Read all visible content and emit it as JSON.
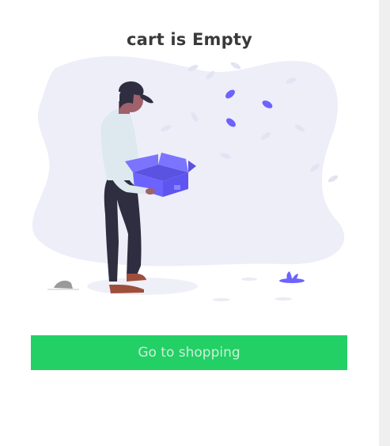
{
  "empty_cart": {
    "title": "cart is Empty",
    "button_label": "Go to shopping",
    "illustration": "man-holding-open-box-illustration"
  },
  "colors": {
    "button": "#22d065",
    "button_text": "#cdeed6",
    "title": "#3a3a3a",
    "blob": "#eeeef9",
    "box": "#6c63ff"
  }
}
